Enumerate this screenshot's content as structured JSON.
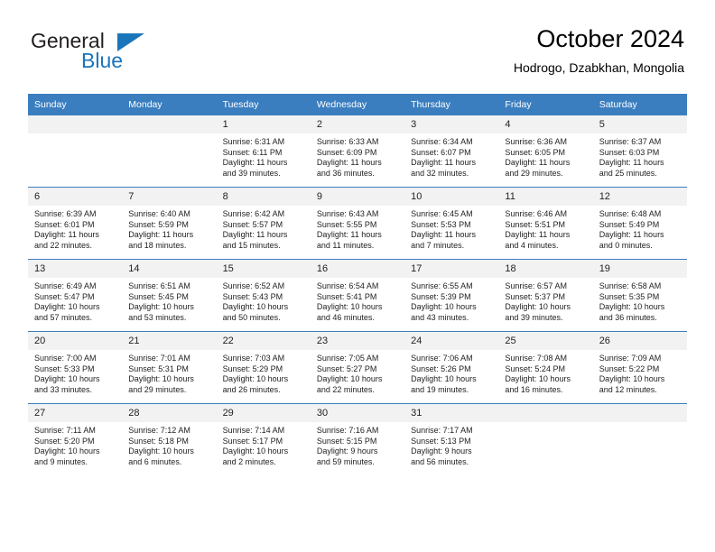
{
  "brand": {
    "line1": "General",
    "line2": "Blue",
    "accent_color": "#1b75bb",
    "triangle_icon": "triangle-icon"
  },
  "header": {
    "title": "October 2024",
    "subtitle": "Hodrogo, Dzabkhan, Mongolia"
  },
  "theme": {
    "header_blue": "#3b7ec0",
    "daynum_band": "#f2f2f2",
    "text": "#222222"
  },
  "weekday_headers": [
    "Sunday",
    "Monday",
    "Tuesday",
    "Wednesday",
    "Thursday",
    "Friday",
    "Saturday"
  ],
  "labels": {
    "sunrise_prefix": "Sunrise: ",
    "sunset_prefix": "Sunset: ",
    "daylight_prefix": "Daylight: "
  },
  "weeks": [
    [
      {
        "day": "",
        "sunrise": "",
        "sunset": "",
        "daylight_line1": "",
        "daylight_line2": ""
      },
      {
        "day": "",
        "sunrise": "",
        "sunset": "",
        "daylight_line1": "",
        "daylight_line2": ""
      },
      {
        "day": "1",
        "sunrise": "Sunrise: 6:31 AM",
        "sunset": "Sunset: 6:11 PM",
        "daylight_line1": "Daylight: 11 hours",
        "daylight_line2": "and 39 minutes."
      },
      {
        "day": "2",
        "sunrise": "Sunrise: 6:33 AM",
        "sunset": "Sunset: 6:09 PM",
        "daylight_line1": "Daylight: 11 hours",
        "daylight_line2": "and 36 minutes."
      },
      {
        "day": "3",
        "sunrise": "Sunrise: 6:34 AM",
        "sunset": "Sunset: 6:07 PM",
        "daylight_line1": "Daylight: 11 hours",
        "daylight_line2": "and 32 minutes."
      },
      {
        "day": "4",
        "sunrise": "Sunrise: 6:36 AM",
        "sunset": "Sunset: 6:05 PM",
        "daylight_line1": "Daylight: 11 hours",
        "daylight_line2": "and 29 minutes."
      },
      {
        "day": "5",
        "sunrise": "Sunrise: 6:37 AM",
        "sunset": "Sunset: 6:03 PM",
        "daylight_line1": "Daylight: 11 hours",
        "daylight_line2": "and 25 minutes."
      }
    ],
    [
      {
        "day": "6",
        "sunrise": "Sunrise: 6:39 AM",
        "sunset": "Sunset: 6:01 PM",
        "daylight_line1": "Daylight: 11 hours",
        "daylight_line2": "and 22 minutes."
      },
      {
        "day": "7",
        "sunrise": "Sunrise: 6:40 AM",
        "sunset": "Sunset: 5:59 PM",
        "daylight_line1": "Daylight: 11 hours",
        "daylight_line2": "and 18 minutes."
      },
      {
        "day": "8",
        "sunrise": "Sunrise: 6:42 AM",
        "sunset": "Sunset: 5:57 PM",
        "daylight_line1": "Daylight: 11 hours",
        "daylight_line2": "and 15 minutes."
      },
      {
        "day": "9",
        "sunrise": "Sunrise: 6:43 AM",
        "sunset": "Sunset: 5:55 PM",
        "daylight_line1": "Daylight: 11 hours",
        "daylight_line2": "and 11 minutes."
      },
      {
        "day": "10",
        "sunrise": "Sunrise: 6:45 AM",
        "sunset": "Sunset: 5:53 PM",
        "daylight_line1": "Daylight: 11 hours",
        "daylight_line2": "and 7 minutes."
      },
      {
        "day": "11",
        "sunrise": "Sunrise: 6:46 AM",
        "sunset": "Sunset: 5:51 PM",
        "daylight_line1": "Daylight: 11 hours",
        "daylight_line2": "and 4 minutes."
      },
      {
        "day": "12",
        "sunrise": "Sunrise: 6:48 AM",
        "sunset": "Sunset: 5:49 PM",
        "daylight_line1": "Daylight: 11 hours",
        "daylight_line2": "and 0 minutes."
      }
    ],
    [
      {
        "day": "13",
        "sunrise": "Sunrise: 6:49 AM",
        "sunset": "Sunset: 5:47 PM",
        "daylight_line1": "Daylight: 10 hours",
        "daylight_line2": "and 57 minutes."
      },
      {
        "day": "14",
        "sunrise": "Sunrise: 6:51 AM",
        "sunset": "Sunset: 5:45 PM",
        "daylight_line1": "Daylight: 10 hours",
        "daylight_line2": "and 53 minutes."
      },
      {
        "day": "15",
        "sunrise": "Sunrise: 6:52 AM",
        "sunset": "Sunset: 5:43 PM",
        "daylight_line1": "Daylight: 10 hours",
        "daylight_line2": "and 50 minutes."
      },
      {
        "day": "16",
        "sunrise": "Sunrise: 6:54 AM",
        "sunset": "Sunset: 5:41 PM",
        "daylight_line1": "Daylight: 10 hours",
        "daylight_line2": "and 46 minutes."
      },
      {
        "day": "17",
        "sunrise": "Sunrise: 6:55 AM",
        "sunset": "Sunset: 5:39 PM",
        "daylight_line1": "Daylight: 10 hours",
        "daylight_line2": "and 43 minutes."
      },
      {
        "day": "18",
        "sunrise": "Sunrise: 6:57 AM",
        "sunset": "Sunset: 5:37 PM",
        "daylight_line1": "Daylight: 10 hours",
        "daylight_line2": "and 39 minutes."
      },
      {
        "day": "19",
        "sunrise": "Sunrise: 6:58 AM",
        "sunset": "Sunset: 5:35 PM",
        "daylight_line1": "Daylight: 10 hours",
        "daylight_line2": "and 36 minutes."
      }
    ],
    [
      {
        "day": "20",
        "sunrise": "Sunrise: 7:00 AM",
        "sunset": "Sunset: 5:33 PM",
        "daylight_line1": "Daylight: 10 hours",
        "daylight_line2": "and 33 minutes."
      },
      {
        "day": "21",
        "sunrise": "Sunrise: 7:01 AM",
        "sunset": "Sunset: 5:31 PM",
        "daylight_line1": "Daylight: 10 hours",
        "daylight_line2": "and 29 minutes."
      },
      {
        "day": "22",
        "sunrise": "Sunrise: 7:03 AM",
        "sunset": "Sunset: 5:29 PM",
        "daylight_line1": "Daylight: 10 hours",
        "daylight_line2": "and 26 minutes."
      },
      {
        "day": "23",
        "sunrise": "Sunrise: 7:05 AM",
        "sunset": "Sunset: 5:27 PM",
        "daylight_line1": "Daylight: 10 hours",
        "daylight_line2": "and 22 minutes."
      },
      {
        "day": "24",
        "sunrise": "Sunrise: 7:06 AM",
        "sunset": "Sunset: 5:26 PM",
        "daylight_line1": "Daylight: 10 hours",
        "daylight_line2": "and 19 minutes."
      },
      {
        "day": "25",
        "sunrise": "Sunrise: 7:08 AM",
        "sunset": "Sunset: 5:24 PM",
        "daylight_line1": "Daylight: 10 hours",
        "daylight_line2": "and 16 minutes."
      },
      {
        "day": "26",
        "sunrise": "Sunrise: 7:09 AM",
        "sunset": "Sunset: 5:22 PM",
        "daylight_line1": "Daylight: 10 hours",
        "daylight_line2": "and 12 minutes."
      }
    ],
    [
      {
        "day": "27",
        "sunrise": "Sunrise: 7:11 AM",
        "sunset": "Sunset: 5:20 PM",
        "daylight_line1": "Daylight: 10 hours",
        "daylight_line2": "and 9 minutes."
      },
      {
        "day": "28",
        "sunrise": "Sunrise: 7:12 AM",
        "sunset": "Sunset: 5:18 PM",
        "daylight_line1": "Daylight: 10 hours",
        "daylight_line2": "and 6 minutes."
      },
      {
        "day": "29",
        "sunrise": "Sunrise: 7:14 AM",
        "sunset": "Sunset: 5:17 PM",
        "daylight_line1": "Daylight: 10 hours",
        "daylight_line2": "and 2 minutes."
      },
      {
        "day": "30",
        "sunrise": "Sunrise: 7:16 AM",
        "sunset": "Sunset: 5:15 PM",
        "daylight_line1": "Daylight: 9 hours",
        "daylight_line2": "and 59 minutes."
      },
      {
        "day": "31",
        "sunrise": "Sunrise: 7:17 AM",
        "sunset": "Sunset: 5:13 PM",
        "daylight_line1": "Daylight: 9 hours",
        "daylight_line2": "and 56 minutes."
      },
      {
        "day": "",
        "sunrise": "",
        "sunset": "",
        "daylight_line1": "",
        "daylight_line2": ""
      },
      {
        "day": "",
        "sunrise": "",
        "sunset": "",
        "daylight_line1": "",
        "daylight_line2": ""
      }
    ]
  ]
}
